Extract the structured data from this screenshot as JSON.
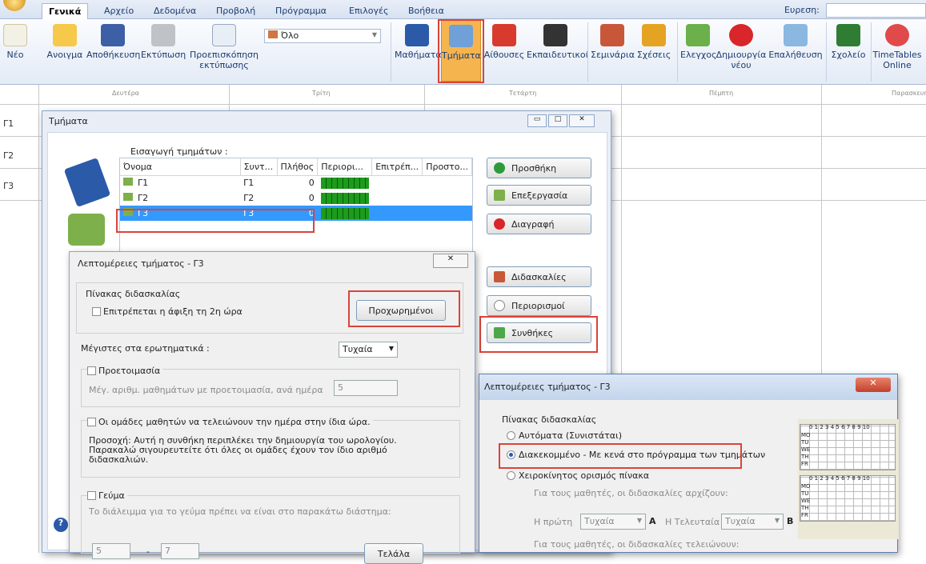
{
  "menu": {
    "tabs": [
      "Γενικά",
      "Αρχείο",
      "Δεδομένα",
      "Προβολή",
      "Πρόγραμμα",
      "Επιλογές",
      "Βοήθεια"
    ],
    "search_label": "Ευρεση:"
  },
  "ribbon": {
    "buttons": [
      "Νέο",
      "Ανοιγμα",
      "Αποθήκευση",
      "Εκτύπωση",
      "Προεπισκόπηση εκτύπωσης",
      "Μαθήματα",
      "Τμήματα",
      "Αίθουσες",
      "Εκπαιδευτικοί",
      "Σεμινάρια",
      "Σχέσεις",
      "Ελεγχος",
      "Δημιουργία νέου",
      "Επαλήθευση",
      "Σχολείο",
      "TimeTables Online"
    ],
    "combo_value": "Όλο"
  },
  "grid": {
    "day_headers": [
      "Δευτέρα",
      "Τρίτη",
      "Τετάρτη",
      "Πέμπτη",
      "Παρασκευή"
    ],
    "rows": [
      "Γ1",
      "Γ2",
      "Γ3"
    ]
  },
  "dialog_classes": {
    "title": "Τμήματα",
    "list_label": "Εισαγωγή τμημάτων :",
    "columns": [
      "Όνομα",
      "Συντ...",
      "Πλήθος",
      "Περιορι...",
      "Επιτρέπ...",
      "Προστο..."
    ],
    "rows": [
      {
        "name": "Γ1",
        "abbr": "Γ1",
        "count": "0"
      },
      {
        "name": "Γ2",
        "abbr": "Γ2",
        "count": "0"
      },
      {
        "name": "Γ3",
        "abbr": "Γ3",
        "count": "0"
      }
    ],
    "buttons": [
      "Προσθήκη",
      "Επεξεργασία",
      "Διαγραφή",
      "Διδασκαλίες",
      "Περιορισμοί",
      "Συνθήκες"
    ]
  },
  "dialog_details1": {
    "title": "Λεπτομέρειες τμήματος - Γ3",
    "section_table": "Πίνακας διδασκαλίας",
    "chk_second_hour": "Επιτρέπεται η άφιξη τη 2η ώρα",
    "btn_advanced": "Προχωρημένοι",
    "max_label": "Μέγιστες στα ερωτηματικά :",
    "max_value": "Τυχαία",
    "chk_prep": "Προετοιμασία",
    "prep_desc": "Μέγ. αριθμ. μαθημάτων με προετοιμασία, ανά ημέρα",
    "prep_value": "5",
    "chk_groups": "Οι ομάδες μαθητών να τελειώνουν την ημέρα στην ίδια ώρα.",
    "warning": "Προσοχή: Αυτή η συνθήκη περιπλέκει την δημιουργία του ωρολογίου. Παρακαλώ σιγουρευτείτε ότι όλες οι ομάδες έχουν τον ίδιο αριθμό διδασκαλιών.",
    "chk_lunch": "Γεύμα",
    "lunch_desc": "Το διάλειμμα για το γεύμα πρέπει να είναι στο παρακάτω διάστημα:",
    "lunch_from": "5",
    "lunch_dash": "-",
    "lunch_to": "7",
    "btn_end": "Τελάλα"
  },
  "dialog_details2": {
    "title": "Λεπτομέρειες τμήματος - Γ3",
    "section_table": "Πίνακας διδασκαλίας",
    "opt_auto": "Αυτόματα (Συνιστάται)",
    "opt_interrupted": "Διακεκομμένο - Με κενά στο πρόγραμμα των τμημάτων",
    "opt_manual": "Χειροκίνητος ορισμός πίνακα",
    "start_desc": "Για τους μαθητές, οι διδασκαλίες αρχίζουν:",
    "first_label": "Η πρώτη",
    "first_value": "Τυχαία",
    "a_letter": "A",
    "last_label": "Η Τελευταία",
    "last_value": "Τυχαία",
    "b_letter": "B",
    "end_desc": "Για τους μαθητές, οι διδασκαλίες τελειώνουν:",
    "mini_header": "0 1 2 3 4 5 6 7 8 9 10",
    "mini_days": [
      "MO",
      "TU",
      "WE",
      "TH",
      "FR"
    ]
  }
}
